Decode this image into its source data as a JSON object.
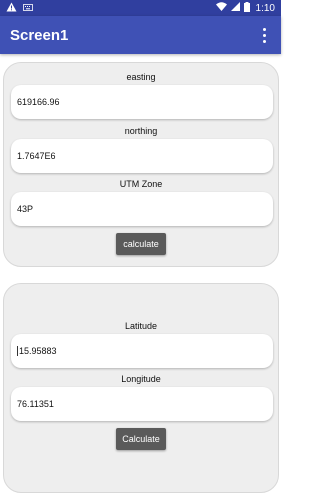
{
  "status_bar": {
    "left_icons": [
      "warning-icon",
      "keyboard-icon"
    ],
    "right_icons": [
      "wifi-icon",
      "signal-icon",
      "battery-icon"
    ],
    "time": "1:10"
  },
  "app_bar": {
    "title": "Screen1",
    "menu_icon": "more-vert-icon"
  },
  "utm_card": {
    "easting_label": "easting",
    "easting_value": "619166.96",
    "northing_label": "northing",
    "northing_value": "1.7647E6",
    "zone_label": "UTM Zone",
    "zone_value": "43P",
    "button_label": "calculate"
  },
  "latlon_card": {
    "latitude_label": "Latitude",
    "latitude_value": "15.95883",
    "longitude_label": "Longitude",
    "longitude_value": "76.11351",
    "button_label": "Calculate"
  },
  "colors": {
    "status_bar": "#303F9F",
    "app_bar": "#3F51B5",
    "card_bg": "#eeeeee",
    "button_bg": "#5a5a5a"
  }
}
